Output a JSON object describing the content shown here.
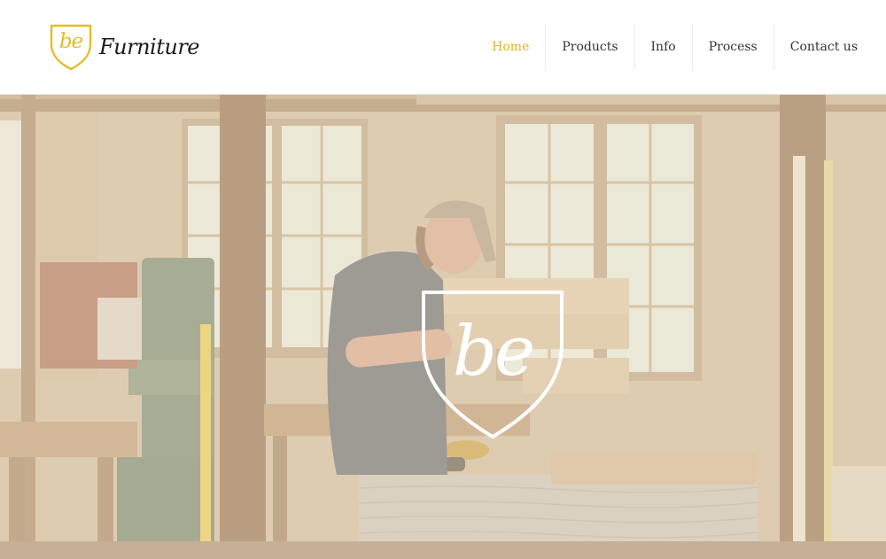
{
  "brand": {
    "mark_text": "be",
    "name": "Furniture",
    "accent_color": "#e8bd25"
  },
  "nav": {
    "items": [
      {
        "label": "Home",
        "active": true
      },
      {
        "label": "Products",
        "active": false
      },
      {
        "label": "Info",
        "active": false
      },
      {
        "label": "Process",
        "active": false
      },
      {
        "label": "Contact us",
        "active": false
      }
    ],
    "active_color": "#e2b327",
    "text_color": "#333333"
  },
  "hero": {
    "emblem_text": "be",
    "emblem_icon": "shield-icon",
    "image_subject": "woodworker-sanding-in-workshop-image"
  }
}
